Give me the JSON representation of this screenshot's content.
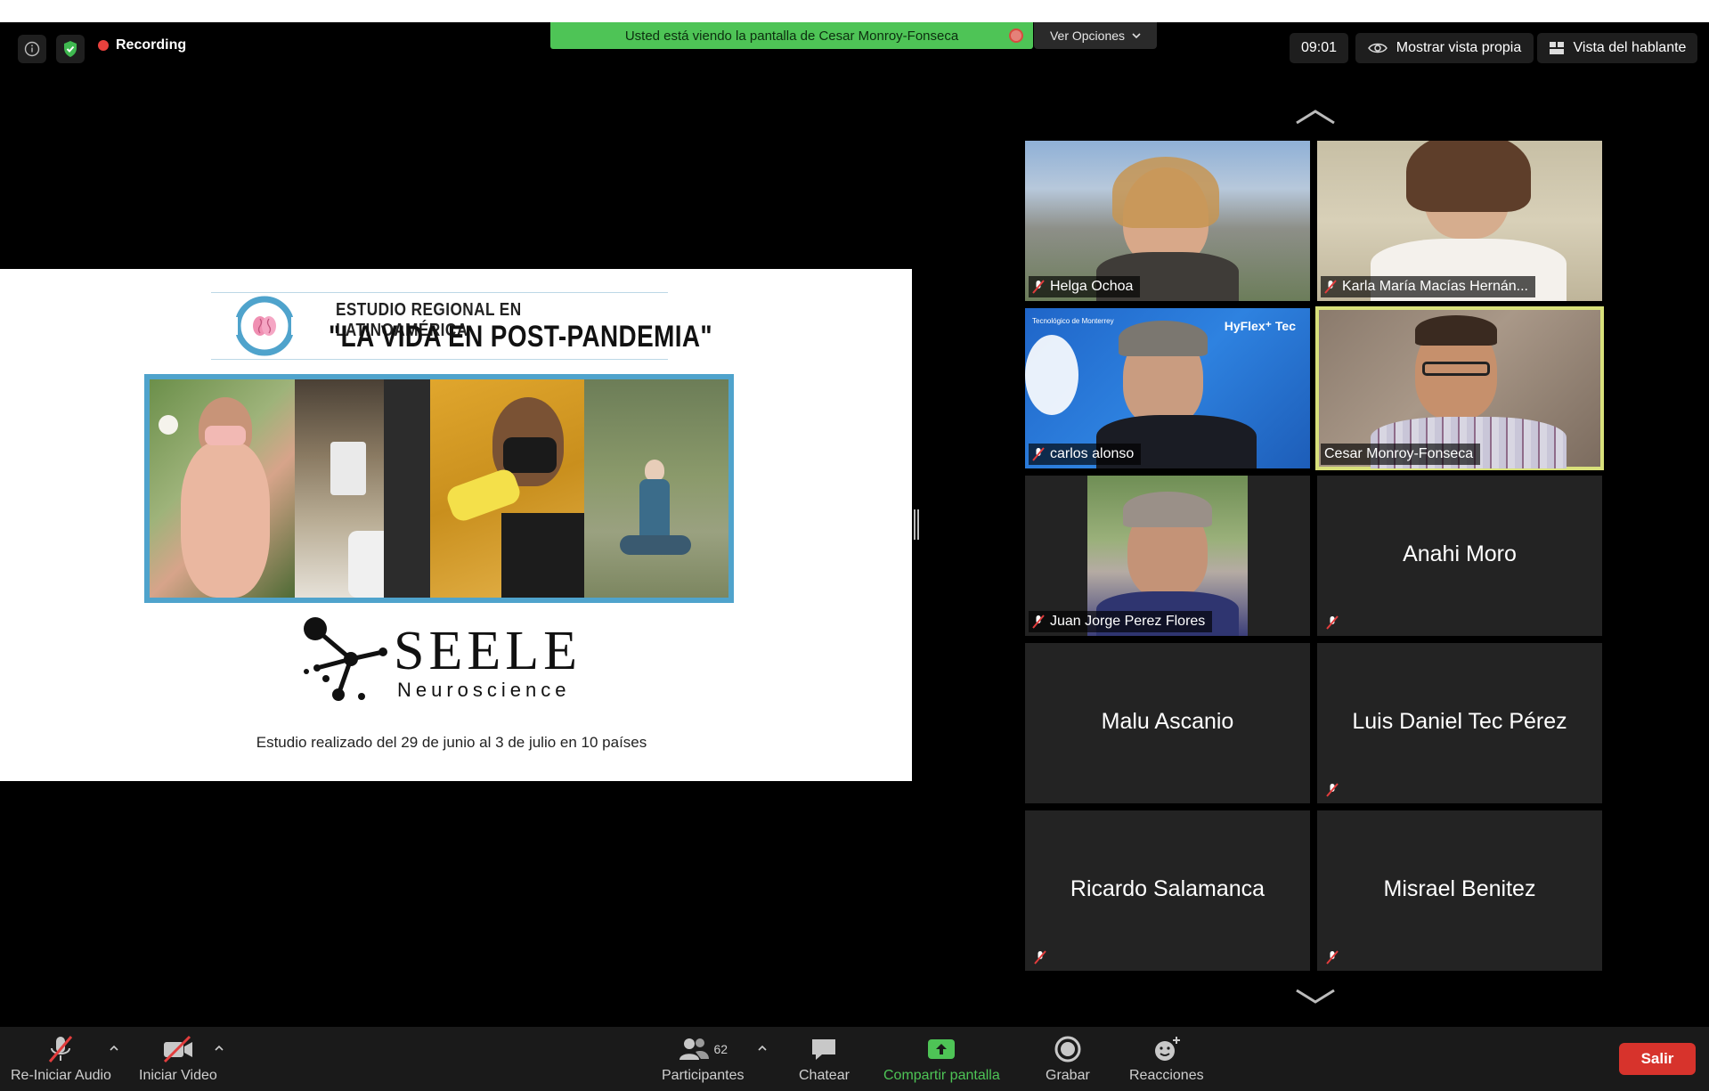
{
  "top_bar": {
    "recording_label": "Recording",
    "share_banner": "Usted está viendo la pantalla de Cesar Monroy-Fonseca",
    "view_options": "Ver Opciones",
    "timer": "09:01",
    "own_view": "Mostrar vista propia",
    "speaker_view": "Vista del hablante"
  },
  "slide": {
    "subtitle": "ESTUDIO REGIONAL EN LATINOAMÉRICA",
    "title": "\"LA VIDA EN POST-PANDEMIA\"",
    "logo_word": "SEELE",
    "logo_sub": "Neuroscience",
    "caption": "Estudio realizado del 29 de junio al 3 de julio en 10 países"
  },
  "participants": [
    {
      "name": "Helga Ochoa",
      "muted": true,
      "video": true
    },
    {
      "name": "Karla María Macías Hernán...",
      "muted": true,
      "video": true
    },
    {
      "name": "carlos alonso",
      "muted": true,
      "video": true,
      "overlay_text": "HyFlex⁺ Tec",
      "overlay_small": "Tecnológico de Monterrey"
    },
    {
      "name": "Cesar Monroy-Fonseca",
      "muted": false,
      "video": true,
      "active_speaker": true
    },
    {
      "name": "Juan Jorge Perez Flores",
      "muted": true,
      "video": true
    },
    {
      "name": "Anahi Moro",
      "muted": true,
      "video": false
    },
    {
      "name": "Malu Ascanio",
      "muted": false,
      "video": false
    },
    {
      "name": "Luis Daniel Tec Pérez",
      "muted": true,
      "video": false
    },
    {
      "name": "Ricardo Salamanca",
      "muted": true,
      "video": false
    },
    {
      "name": "Misrael Benitez",
      "muted": true,
      "video": false
    }
  ],
  "toolbar": {
    "audio_label": "Re-Iniciar Audio",
    "video_label": "Iniciar Video",
    "participants_label": "Participantes",
    "participants_count": "62",
    "chat_label": "Chatear",
    "share_label": "Compartir pantalla",
    "record_label": "Grabar",
    "reactions_label": "Reacciones",
    "leave_label": "Salir"
  },
  "colors": {
    "banner_green": "#4ec456",
    "recording_red": "#e8413d",
    "active_speaker_border": "#d8e07a",
    "leave_red": "#d7332c",
    "slide_accent_blue": "#4fa3cc"
  }
}
